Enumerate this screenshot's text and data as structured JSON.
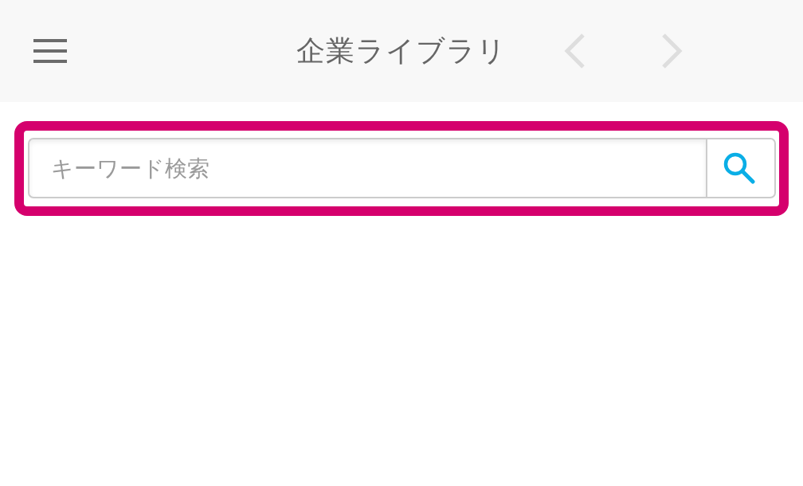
{
  "header": {
    "title": "企業ライブラリ",
    "nav_buttons": [
      {
        "kind": "back",
        "disabled": true
      },
      {
        "kind": "forward",
        "disabled": true
      }
    ]
  },
  "search": {
    "placeholder": "キーワード検索",
    "highlighted": true
  }
}
